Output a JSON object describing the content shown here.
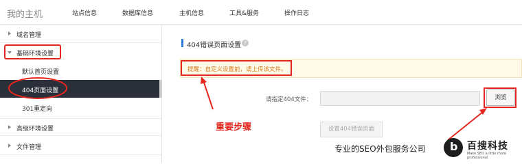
{
  "header": {
    "brand": "我的主机",
    "nav": [
      "站点信息",
      "数据库信息",
      "主机信息",
      "工具&服务",
      "操作日志"
    ]
  },
  "sidebar": {
    "items": [
      {
        "label": "域名管理",
        "expanded": false
      },
      {
        "label": "基础环境设置",
        "expanded": true,
        "children": [
          "默认首页设置",
          "404页面设置",
          "301重定向"
        ],
        "active_child": "404页面设置"
      },
      {
        "label": "高级环境设置",
        "expanded": false
      },
      {
        "label": "文件管理",
        "expanded": false
      }
    ]
  },
  "main": {
    "title": "404错误页面设置",
    "help_icon": "question-circle-icon",
    "tip": "提醒：自定义设置前，请上传该文件。",
    "file_label": "请指定404文件：",
    "file_value": "",
    "browse_label": "浏览",
    "submit_label": "设置404错误页面"
  },
  "annotations": {
    "important": "重要步骤",
    "color": "#e3261e"
  },
  "watermark": {
    "tagline": "专业的SEO外包服务公司",
    "logo_name": "百搜科技",
    "logo_glyph": "b",
    "logo_sub": "Make SEO a little more professional"
  },
  "colors": {
    "accent": "#2e7bd6",
    "active_bg": "#2b2f3a",
    "tip_text": "#d77a1c",
    "annotation": "#e3261e"
  }
}
